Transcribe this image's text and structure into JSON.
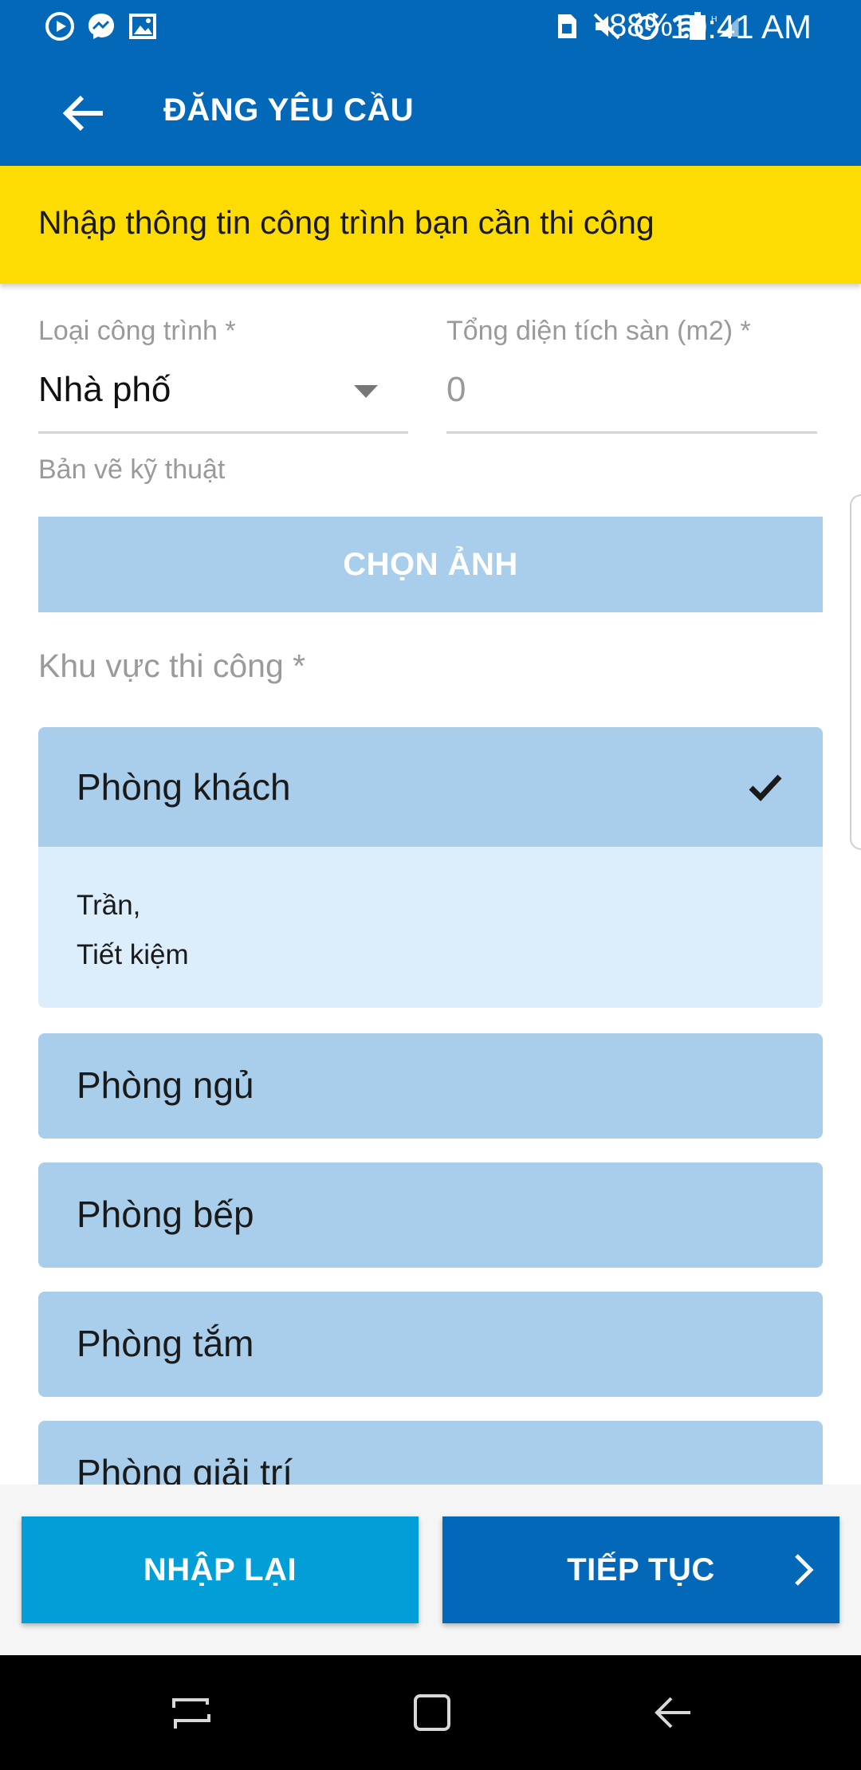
{
  "status_bar": {
    "battery": "88%",
    "time": "10:41 AM",
    "left_icons": [
      "media-icon",
      "messenger-icon",
      "gallery-icon"
    ],
    "right_icons": [
      "sim-icon",
      "mute-icon",
      "alarm-icon",
      "wifi-icon",
      "signal-icon",
      "battery-icon"
    ]
  },
  "app_bar": {
    "title": "ĐĂNG YÊU CẦU",
    "back_icon": "arrow-left-icon"
  },
  "notice": {
    "text": "Nhập thông tin công trình bạn cần thi công"
  },
  "form": {
    "building_type": {
      "label": "Loại công trình *",
      "value": "Nhà phố"
    },
    "floor_area": {
      "label": "Tổng diện tích sàn (m2) *",
      "value": "0"
    },
    "drawings": {
      "label": "Bản vẽ kỹ thuật",
      "button": "CHỌN ẢNH"
    },
    "area": {
      "label": "Khu vực thi công *",
      "selected": {
        "name": "Phòng khách",
        "details": [
          "Trần,",
          "Tiết kiệm"
        ]
      },
      "rooms": [
        "Phòng ngủ",
        "Phòng bếp",
        "Phòng tắm",
        "Phòng giải trí"
      ]
    }
  },
  "actions": {
    "reset": "NHẬP LẠI",
    "next": "TIẾP TỤC"
  },
  "colors": {
    "primary": "#0368b8",
    "notice": "#fddc04",
    "room_bg": "#a8ceeb",
    "room_detail_bg": "#dceefc",
    "reset_btn": "#029ed8"
  }
}
